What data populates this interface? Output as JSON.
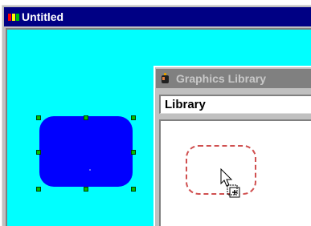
{
  "main_window": {
    "title": "Untitled",
    "canvas_color": "#00ffff",
    "shape_color": "#0000ff"
  },
  "library_window": {
    "title": "Graphics Library",
    "field_text": "Library",
    "item_outline_color": "#d05050"
  },
  "icons": [
    "app-icon",
    "library-icon",
    "arrow-cursor-icon",
    "copy-plus-icon"
  ]
}
